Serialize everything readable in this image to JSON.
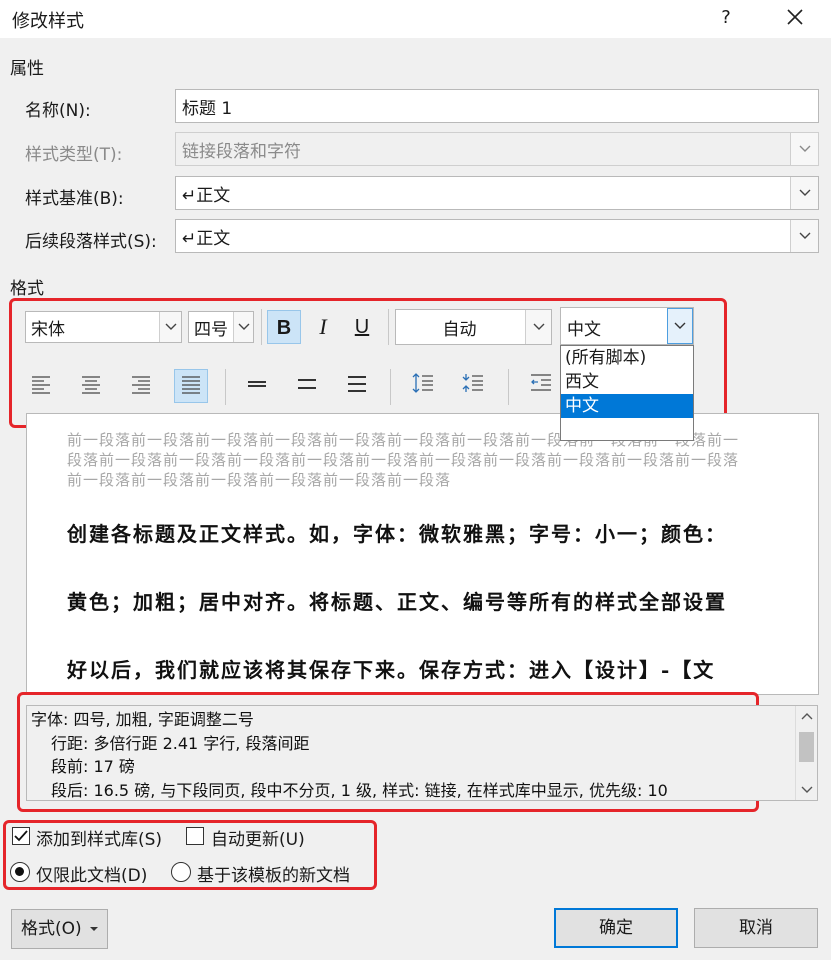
{
  "window": {
    "title": "修改样式",
    "help_label": "?"
  },
  "properties": {
    "section_label": "属性",
    "name": {
      "label": "名称(N):",
      "value": "标题 1"
    },
    "style_type": {
      "label": "样式类型(T):",
      "value": "链接段落和字符"
    },
    "style_based_on": {
      "label": "样式基准(B):",
      "value": "↵正文"
    },
    "next_style": {
      "label": "后续段落样式(S):",
      "value": "↵正文"
    }
  },
  "format": {
    "section_label": "格式",
    "font_name": "宋体",
    "font_size": "四号",
    "bold_label": "B",
    "italic_label": "I",
    "underline_label": "U",
    "color_value": "自动",
    "script_value": "中文",
    "script_options": [
      "(所有脚本)",
      "西文",
      "中文"
    ],
    "script_selected_index": 2
  },
  "preview": {
    "previous_paragraph": "前一段落前一段落前一段落前一段落前一段落前一段落前一段落前一段落前一段落前一段落前一段落前一段落前一段落前一段落前一段落前一段落前一段落前一段落前一段落前一段落前一段落前一段落前一段落前一段落前一段落前一段落前一段落",
    "lines": [
      "创建各标题及正文样式。如，字体：微软雅黑；字号：小一；颜色：",
      "黄色；加粗；居中对齐。将标题、正文、编号等所有的样式全部设置",
      "好以后，我们就应该将其保存下来。保存方式：进入【设计】-【文"
    ]
  },
  "description": {
    "line1": "字体: 四号, 加粗, 字距调整二号",
    "line2": "行距: 多倍行距 2.41 字行, 段落间距",
    "line3": "段前: 17 磅",
    "line4": "段后: 16.5 磅, 与下段同页, 段中不分页, 1 级, 样式: 链接, 在样式库中显示, 优先级: 10"
  },
  "options": {
    "add_to_gallery": {
      "label": "添加到样式库(S)",
      "checked": true
    },
    "auto_update": {
      "label": "自动更新(U)",
      "checked": false
    },
    "only_this_document": {
      "label": "仅限此文档(D)",
      "selected": true
    },
    "new_documents": {
      "label": "基于该模板的新文档",
      "selected": false
    }
  },
  "buttons": {
    "format": "格式(O)",
    "ok": "确定",
    "cancel": "取消"
  },
  "colors": {
    "highlight_border": "#e5252a",
    "selection": "#0078d7",
    "active_button": "#cce4f7"
  }
}
